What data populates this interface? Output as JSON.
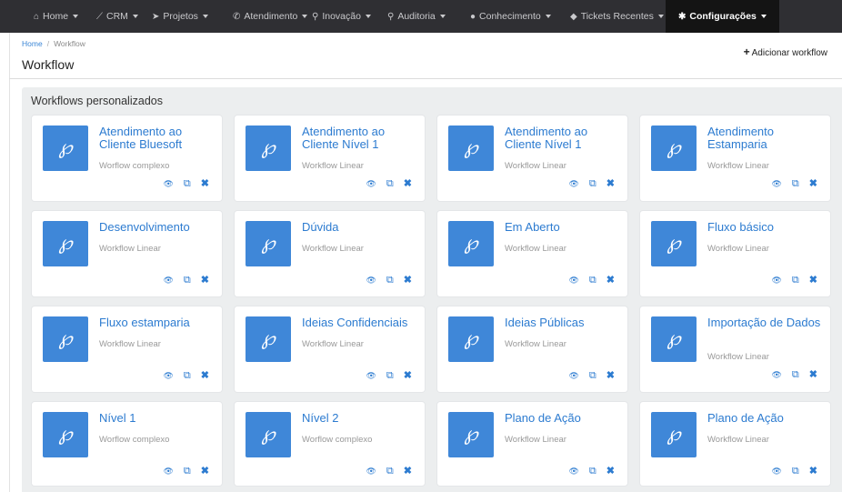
{
  "nav": {
    "items": [
      {
        "icon": "home-icon",
        "glyph": "⌂",
        "label": "Home"
      },
      {
        "icon": "chart-icon",
        "glyph": "⟋",
        "label": "CRM"
      },
      {
        "icon": "send-icon",
        "glyph": "➤",
        "label": "Projetos"
      },
      {
        "icon": "phone-icon",
        "glyph": "✆",
        "label": "Atendimento"
      },
      {
        "icon": "bulb-icon",
        "glyph": "⚲",
        "label": "Inovação"
      },
      {
        "icon": "search-icon",
        "glyph": "⚲",
        "label": "Auditoria"
      },
      {
        "icon": "comments-icon",
        "glyph": "●",
        "label": "Conhecimento"
      },
      {
        "icon": "ticket-icon",
        "glyph": "◆",
        "label": "Tickets Recentes"
      },
      {
        "icon": "gear-icon",
        "glyph": "✱",
        "label": "Configurações"
      }
    ]
  },
  "breadcrumb": {
    "home": "Home",
    "separator": "/",
    "current": "Workflow"
  },
  "page": {
    "title": "Workflow",
    "add_button": "Adicionar workflow",
    "add_glyph": "+"
  },
  "panel": {
    "title": "Workflows personalizados"
  },
  "cards": [
    {
      "name": "Atendimento ao Cliente Bluesoft",
      "type": "Worflow complexo"
    },
    {
      "name": "Atendimento ao Cliente Nível 1",
      "type": "Workflow Linear"
    },
    {
      "name": "Atendimento ao Cliente Nível 1",
      "type": "Workflow Linear"
    },
    {
      "name": "Atendimento Estamparia",
      "type": "Workflow Linear"
    },
    {
      "name": "Desenvolvimento",
      "type": "Workflow Linear"
    },
    {
      "name": "Dúvida",
      "type": "Workflow Linear"
    },
    {
      "name": "Em Aberto",
      "type": "Workflow Linear"
    },
    {
      "name": "Fluxo básico",
      "type": "Workflow Linear"
    },
    {
      "name": "Fluxo estamparia",
      "type": "Workflow Linear"
    },
    {
      "name": "Ideias Confidenciais",
      "type": "Workflow Linear"
    },
    {
      "name": "Ideias Públicas",
      "type": "Workflow Linear"
    },
    {
      "name": "Importação de Dados",
      "type": "Workflow Linear"
    },
    {
      "name": "Nível 1",
      "type": "Worflow complexo"
    },
    {
      "name": "Nível 2",
      "type": "Worflow complexo"
    },
    {
      "name": "Plano de Ação",
      "type": "Workflow Linear"
    },
    {
      "name": "Plano de Ação",
      "type": "Workflow Linear"
    }
  ],
  "card_icon_glyph": "℘",
  "actions": {
    "view_glyph": "👁",
    "copy_glyph": "⧉",
    "delete_glyph": "✖"
  },
  "colors": {
    "navbar": "#2f2f33",
    "navbar_active": "#141414",
    "accent": "#3f87d8",
    "link": "#2c7bd0",
    "panel_bg": "#eceeef"
  }
}
